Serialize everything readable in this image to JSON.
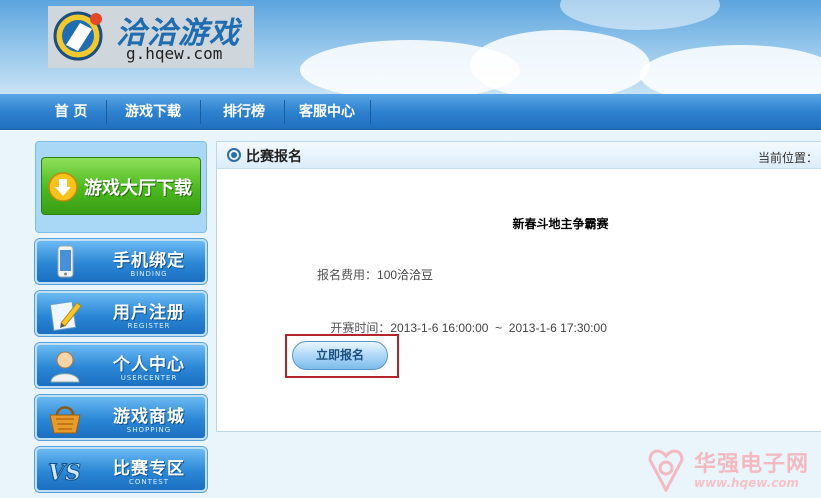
{
  "site": {
    "logo_cn": "洽洽游戏",
    "logo_url": "g.hqew.com"
  },
  "nav": {
    "items": [
      "首 页",
      "游戏下载",
      "排行榜",
      "客服中心"
    ]
  },
  "sidebar": {
    "download": {
      "label": "游戏大厅下载",
      "icon": "download-arrow-icon"
    },
    "items": [
      {
        "label": "手机绑定",
        "sub": "BINDING",
        "icon": "phone-icon"
      },
      {
        "label": "用户注册",
        "sub": "REGISTER",
        "icon": "register-icon"
      },
      {
        "label": "个人中心",
        "sub": "USERCENTER",
        "icon": "user-icon"
      },
      {
        "label": "游戏商城",
        "sub": "SHOPPING",
        "icon": "basket-icon"
      },
      {
        "label": "比赛专区",
        "sub": "CONTEST",
        "icon": "vs-icon"
      }
    ]
  },
  "main": {
    "title": "比赛报名",
    "location_label": "当前位置：",
    "match_name": "新春斗地主争霸赛",
    "fee_label": "报名费用：",
    "fee_value": "100洽洽豆",
    "time_label": "开赛时间：",
    "time_value": "2013-1-6 16:00:00  ~  2013-1-6 17:30:00",
    "signup_button": "立即报名"
  },
  "watermark": {
    "cn": "华强电子网",
    "url": "www.hqew.com"
  },
  "colors": {
    "nav_blue": "#2f82cf",
    "download_green": "#4cb81f",
    "highlight_red": "#b3242b",
    "watermark_pink": "#f3b9c0"
  }
}
